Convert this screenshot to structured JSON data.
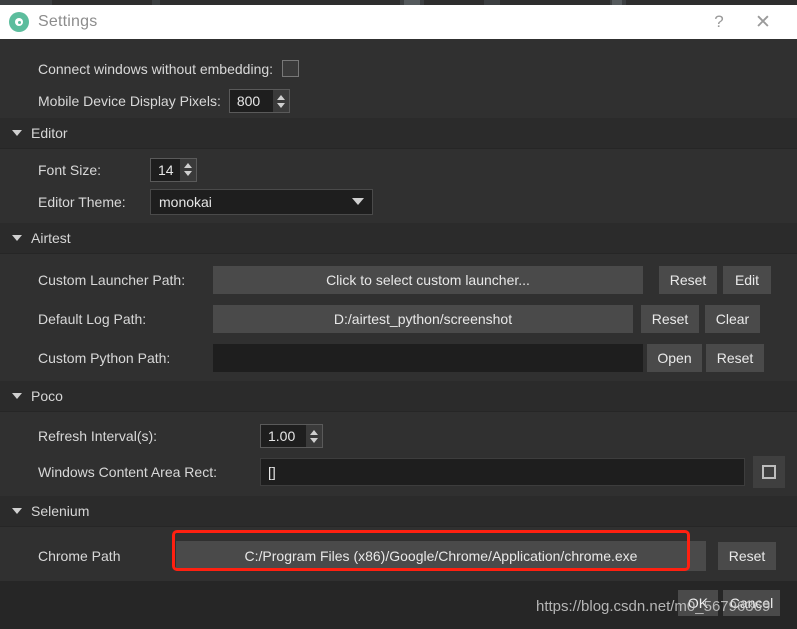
{
  "window": {
    "title": "Settings",
    "icon": "gear-icon",
    "help_label": "?",
    "close_label": "✕",
    "accent_color": "#5cbd9d",
    "titlebar_bg": "#ffffff",
    "body_bg": "#303030",
    "section_bg": "#2b2b2b"
  },
  "general": {
    "rows": [
      {
        "label": "Connect windows without embedding:",
        "control": "checkbox",
        "checked": false
      },
      {
        "label": "Mobile Device Display Pixels:",
        "control": "spinbox",
        "value": "800"
      }
    ]
  },
  "sections": [
    {
      "name": "Editor",
      "expanded": true,
      "rows": [
        {
          "label": "Font Size:",
          "control": "spinbox",
          "value": "14"
        },
        {
          "label": "Editor Theme:",
          "control": "combobox",
          "value": "monokai"
        }
      ]
    },
    {
      "name": "Airtest",
      "expanded": true,
      "rows": [
        {
          "label": "Custom Launcher Path:",
          "control": "pathbutton",
          "value": "Click to select custom launcher...",
          "buttons": [
            "Reset",
            "Edit"
          ]
        },
        {
          "label": "Default Log Path:",
          "control": "pathbutton",
          "value": "D:/airtest_python/screenshot",
          "buttons": [
            "Reset",
            "Clear"
          ]
        },
        {
          "label": "Custom Python Path:",
          "control": "pathbutton",
          "value": "",
          "buttons": [
            "Open",
            "Reset"
          ]
        }
      ]
    },
    {
      "name": "Poco",
      "expanded": true,
      "rows": [
        {
          "label": "Refresh Interval(s):",
          "control": "spinbox",
          "value": "1.00"
        },
        {
          "label": "Windows Content Area Rect:",
          "control": "lineedit",
          "value": "[]",
          "buttons": [
            "select-area-icon"
          ]
        }
      ]
    },
    {
      "name": "Selenium",
      "expanded": true,
      "rows": [
        {
          "label": "Chrome Path",
          "control": "pathbutton",
          "value": "C:/Program Files (x86)/Google/Chrome/Application/chrome.exe",
          "buttons": [
            "Reset"
          ],
          "highlighted": true
        }
      ]
    }
  ],
  "footer": {
    "ok_label": "OK",
    "cancel_label": "Cancel"
  },
  "annotation": {
    "color": "#ff2010",
    "target": "chrome-path-field"
  },
  "watermark": {
    "text": "https://blog.csdn.net/m0_56796369"
  }
}
